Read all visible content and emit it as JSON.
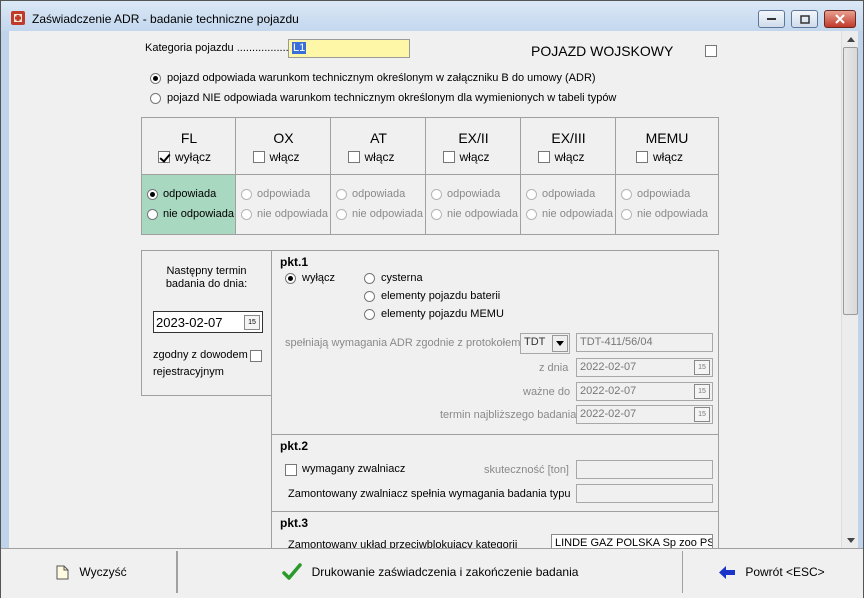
{
  "window": {
    "title": "Zaświadczenie ADR - badanie techniczne pojazdu"
  },
  "category": {
    "label": "Kategoria pojazdu ...................",
    "value": "L1"
  },
  "military": {
    "label": "POJAZD WOJSKOWY",
    "checked": false
  },
  "compliance": {
    "option1": "pojazd odpowiada warunkom technicznym określonym w załączniku B do umowy (ADR)",
    "option2": "pojazd NIE odpowiada warunkom technicznym określonym dla wymienionych w tabeli typów",
    "selected": 1
  },
  "types": [
    {
      "code": "FL",
      "toggle": "wyłącz",
      "checked": true,
      "yes": "odpowiada",
      "no": "nie odpowiada",
      "enabled": true
    },
    {
      "code": "OX",
      "toggle": "włącz",
      "checked": false,
      "yes": "odpowiada",
      "no": "nie odpowiada",
      "enabled": false
    },
    {
      "code": "AT",
      "toggle": "włącz",
      "checked": false,
      "yes": "odpowiada",
      "no": "nie odpowiada",
      "enabled": false
    },
    {
      "code": "EX/II",
      "toggle": "włącz",
      "checked": false,
      "yes": "odpowiada",
      "no": "nie odpowiada",
      "enabled": false
    },
    {
      "code": "EX/III",
      "toggle": "włącz",
      "checked": false,
      "yes": "odpowiada",
      "no": "nie odpowiada",
      "enabled": false
    },
    {
      "code": "MEMU",
      "toggle": "włącz",
      "checked": false,
      "yes": "odpowiada",
      "no": "nie odpowiada",
      "enabled": false
    }
  ],
  "next": {
    "label1": "Następny termin",
    "label2": "badania do dnia:",
    "date": "2023-02-07",
    "cal": "15",
    "consistent1": "zgodny z dowodem",
    "consistent2": "rejestracyjnym"
  },
  "pkt1": {
    "title": "pkt.1",
    "off": "wyłącz",
    "tank": "cysterna",
    "battery": "elementy pojazdu baterii",
    "memu": "elementy pojazdu MEMU",
    "protocol_label": "spełniają wymagania ADR zgodnie z protokołem",
    "protocol_type": "TDT",
    "protocol_no": "TDT-411/56/04",
    "date_label": "z dnia",
    "date": "2022-02-07",
    "valid_label": "ważne do",
    "valid": "2022-02-07",
    "nearest_label": "termin najbliższego badania",
    "nearest": "2022-02-07"
  },
  "pkt2": {
    "title": "pkt.2",
    "required": "wymagany zwalniacz",
    "efficiency": "skuteczność [ton]",
    "installed": "Zamontowany zwalniacz spełnia wymagania badania typu"
  },
  "pkt3": {
    "title": "pkt.3",
    "label": "Zamontowany układ przeciwblokujący kategorii",
    "value": "LINDE GAZ POLSKA Sp zoo PS"
  },
  "buttons": {
    "clear": "Wyczyść",
    "print": "Drukowanie zaświadczenia i zakończenie badania",
    "back": "Powrót <ESC>"
  },
  "colors": {
    "selected_cell": "#a8d8c0",
    "field_highlight": "#fff7a8",
    "window_frame": "#bfd3ea"
  }
}
